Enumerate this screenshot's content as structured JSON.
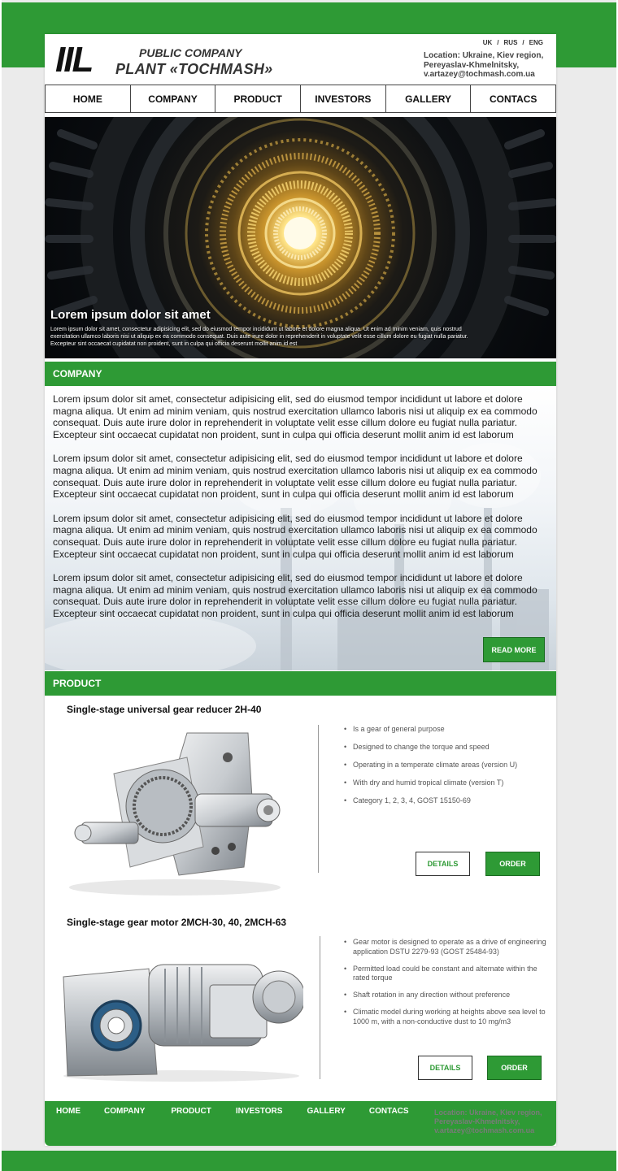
{
  "header": {
    "logo_mark": "IIL",
    "logo_line1": "PUBLIC COMPANY",
    "logo_line2": "PLANT «TOCHMASH»",
    "languages": [
      "UK",
      "RUS",
      "ENG"
    ],
    "separator": "/",
    "location": "Location: Ukraine, Kiev region, Pereyaslav-Khmelnitsky, v.artazey@tochmash.com.ua"
  },
  "nav": {
    "items": [
      "HOME",
      "COMPANY",
      "PRODUCT",
      "INVESTORS",
      "GALLERY",
      "CONTACS"
    ]
  },
  "hero": {
    "title": "Lorem ipsum dolor sit amet",
    "text": "Lorem ipsum dolor sit amet, consectetur adipisicing elit, sed do eiusmod tempor incididunt ut labore et dolore magna aliqua. Ut enim ad minim veniam, quis nostrud exercitation ullamco laboris nisi ut aliquip ex ea commodo consequat. Duis aute irure dolor in reprehenderit in voluptate velit esse cillum dolore eu fugiat nulla pariatur. Excepteur sint occaecat cupidatat non proident, sunt in culpa qui officia deserunt mollit anim id est"
  },
  "company": {
    "heading": "COMPANY",
    "paragraphs": [
      "Lorem ipsum dolor sit amet, consectetur adipisicing elit, sed do eiusmod tempor incididunt ut labore et dolore magna aliqua. Ut enim ad minim veniam, quis nostrud exercitation ullamco laboris nisi ut aliquip ex ea commodo consequat. Duis aute irure dolor in reprehenderit in voluptate velit esse cillum dolore eu fugiat nulla pariatur. Excepteur sint occaecat cupidatat non proident, sunt in culpa qui officia deserunt mollit anim id est laborum",
      "Lorem ipsum dolor sit amet, consectetur adipisicing elit, sed do eiusmod tempor incididunt ut labore et dolore magna aliqua. Ut enim ad minim veniam, quis nostrud exercitation ullamco laboris nisi ut aliquip ex ea commodo consequat. Duis aute irure dolor in reprehenderit in voluptate velit esse cillum dolore eu fugiat nulla pariatur. Excepteur sint occaecat cupidatat non proident, sunt in culpa qui officia deserunt mollit anim id est laborum",
      "Lorem ipsum dolor sit amet, consectetur adipisicing elit, sed do eiusmod tempor incididunt ut labore et dolore magna aliqua. Ut enim ad minim veniam, quis nostrud exercitation ullamco laboris nisi ut aliquip ex ea commodo consequat. Duis aute irure dolor in reprehenderit in voluptate velit esse cillum dolore eu fugiat nulla pariatur. Excepteur sint occaecat cupidatat non proident, sunt in culpa qui officia deserunt mollit anim id est laborum",
      "Lorem ipsum dolor sit amet, consectetur adipisicing elit, sed do eiusmod tempor incididunt ut labore et dolore magna aliqua. Ut enim ad minim veniam, quis nostrud exercitation ullamco laboris nisi ut aliquip ex ea commodo consequat. Duis aute irure dolor in reprehenderit in voluptate velit esse cillum dolore eu fugiat nulla pariatur. Excepteur sint occaecat cupidatat non proident, sunt in culpa qui officia deserunt mollit anim id est laborum"
    ],
    "read_more": "READ MORE"
  },
  "product": {
    "heading": "PRODUCT",
    "items": [
      {
        "title": "Single-stage universal gear reducer 2H-40",
        "features": [
          "Is a gear of general purpose",
          "Designed to change the torque and speed",
          "Operating in a temperate climate areas (version U)",
          "With dry and humid tropical climate (version T)",
          "Category 1, 2, 3, 4, GOST 15150-69"
        ],
        "details": "DETAILS",
        "order": "ORDER"
      },
      {
        "title": "Single-stage gear motor 2MCH-30, 40, 2MCH-63",
        "features": [
          "Gear motor is designed to operate as a drive of engineering application DSTU 2279-93 (GOST 25484-93)",
          "Permitted load could be constant and alternate within the rated torque",
          "Shaft rotation in any direction without preference",
          "Climatic model during working at heights above sea level to 1000 m, with a non-conductive dust to 10 mg/m3"
        ],
        "details": "DETAILS",
        "order": "ORDER"
      }
    ]
  },
  "footer": {
    "nav": [
      "HOME",
      "COMPANY",
      "PRODUCT",
      "INVESTORS",
      "GALLERY",
      "CONTACS"
    ],
    "location": "Location: Ukraine, Kiev region, Pereyaslav-Khmelnitsky, v.artazey@tochmash.com.ua"
  },
  "colors": {
    "brand_green": "#2e9a35",
    "page_bg": "#ebebeb",
    "text": "#222222"
  }
}
